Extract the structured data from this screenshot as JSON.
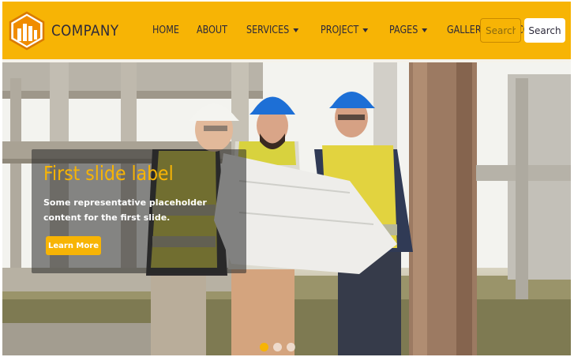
{
  "brand": {
    "name": "COMPANY",
    "logo_icon": "building-logo-icon"
  },
  "nav": {
    "items": [
      {
        "label": "HOME",
        "dropdown": false
      },
      {
        "label": "ABOUT",
        "dropdown": false
      },
      {
        "label": "SERVICES",
        "dropdown": true
      },
      {
        "label": "PROJECT",
        "dropdown": true
      },
      {
        "label": "PAGES",
        "dropdown": true
      },
      {
        "label": "GALLERY",
        "dropdown": true
      },
      {
        "label": "CONTACT",
        "dropdown": false
      }
    ]
  },
  "search": {
    "placeholder": "Search",
    "button_label": "Search"
  },
  "carousel": {
    "caption_title": "First slide label",
    "caption_text": "Some representative placeholder content for the first slide.",
    "button_label": "Learn More",
    "slide_count": 3,
    "active_index": 0
  },
  "colors": {
    "accent": "#f7b405",
    "dark_text": "#2d2a3a",
    "white": "#ffffff"
  }
}
